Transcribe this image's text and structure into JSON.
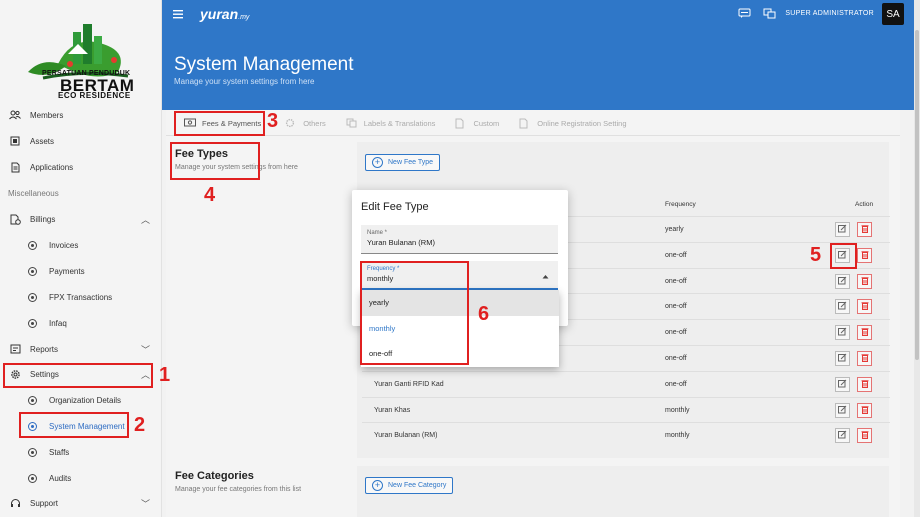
{
  "sidebar": {
    "logo": {
      "line1": "PERSATUAN PENDUDUK",
      "line2": "BERTAM",
      "line3": "ECO RESIDENCE"
    },
    "items": [
      {
        "label": "Members",
        "icon": "members-icon"
      },
      {
        "label": "Assets",
        "icon": "assets-icon"
      },
      {
        "label": "Applications",
        "icon": "applications-icon"
      }
    ],
    "section_misc": "Miscellaneous",
    "billings": {
      "label": "Billings",
      "children": [
        "Invoices",
        "Payments",
        "FPX Transactions",
        "Infaq"
      ]
    },
    "reports": "Reports",
    "settings": {
      "label": "Settings",
      "children": [
        "Organization Details",
        "System Management",
        "Staffs",
        "Audits"
      ]
    },
    "support": "Support"
  },
  "header": {
    "brand": "yuran",
    "brand_suffix": ".my",
    "user": "SUPER ADMINISTRATOR",
    "avatar": "SA",
    "title": "System Management",
    "subtitle": "Manage your system settings from here"
  },
  "tabs": [
    "Fees & Payments",
    "Others",
    "Labels & Translations",
    "Custom",
    "Online Registration Setting"
  ],
  "fee_types": {
    "title": "Fee Types",
    "subtitle": "Manage your system settings from here",
    "new_button": "New Fee Type",
    "col_frequency": "Frequency",
    "col_action": "Action",
    "rows": [
      {
        "name": "",
        "frequency": "yearly"
      },
      {
        "name": "",
        "frequency": "one-off"
      },
      {
        "name": "",
        "frequency": "one-off"
      },
      {
        "name": "",
        "frequency": "one-off"
      },
      {
        "name": "",
        "frequency": "one-off"
      },
      {
        "name": "",
        "frequency": "one-off"
      },
      {
        "name": "Yuran Ganti RFID Kad",
        "frequency": "one-off"
      },
      {
        "name": "Yuran Khas",
        "frequency": "monthly"
      },
      {
        "name": "Yuran Bulanan (RM)",
        "frequency": "monthly"
      }
    ]
  },
  "fee_categories": {
    "title": "Fee Categories",
    "subtitle": "Manage your fee categories from this list",
    "new_button": "New Fee Category"
  },
  "modal": {
    "title": "Edit Fee Type",
    "name_label": "Name *",
    "name_value": "Yuran Bulanan (RM)",
    "freq_label": "Frequency *",
    "freq_value": "monthly",
    "options": [
      "yearly",
      "monthly",
      "one-off"
    ]
  },
  "annotations": [
    "1",
    "2",
    "3",
    "4",
    "5",
    "6"
  ],
  "colors": {
    "primary": "#2f77c8",
    "highlight": "#e02020",
    "delete": "#e53935"
  }
}
